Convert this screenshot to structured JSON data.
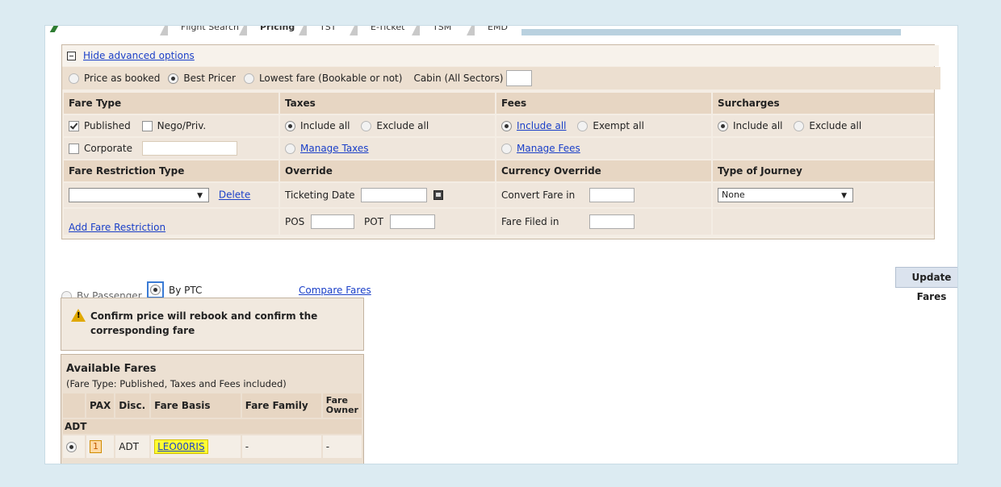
{
  "tabs": [
    "Flight Search",
    "Pricing",
    "TST",
    "E-Ticket",
    "TSM",
    "EMD"
  ],
  "options": {
    "hide_advanced": "Hide advanced options",
    "price_as_booked": "Price as booked",
    "best_pricer": "Best Pricer",
    "lowest_fare": "Lowest fare (Bookable or not)",
    "cabin_label": "Cabin (All Sectors)",
    "cabin_value": ""
  },
  "grid": {
    "fare_type": "Fare Type",
    "taxes": "Taxes",
    "fees": "Fees",
    "surcharges": "Surcharges",
    "published": "Published",
    "nego_priv": "Nego/Priv.",
    "tax_include_all": "Include all",
    "tax_exclude_all": "Exclude all",
    "fee_include_all": "Include all",
    "fee_exempt_all": "Exempt all",
    "sur_include_all": "Include all",
    "sur_exclude_all": "Exclude all",
    "corporate": "Corporate",
    "manage_taxes": "Manage Taxes",
    "manage_fees": "Manage Fees",
    "fare_restriction_type": "Fare Restriction Type",
    "override": "Override",
    "currency_override": "Currency Override",
    "type_of_journey": "Type of Journey",
    "restriction_select": "",
    "delete": "Delete",
    "ticketing_date": "Ticketing Date",
    "convert_fare_in": "Convert Fare in",
    "journey_select": "None",
    "add_fare_restriction": "Add Fare Restriction",
    "pos": "POS",
    "pot": "POT",
    "fare_filed_in": "Fare Filed in"
  },
  "update_fares": "Update Fares",
  "view": {
    "by_passenger": "By Passenger",
    "by_ptc": "By PTC",
    "compare_fares": "Compare Fares"
  },
  "warning": "Confirm price will rebook and confirm the corresponding fare",
  "fares": {
    "title": "Available Fares",
    "subtitle": "(Fare Type: Published, Taxes and Fees included)",
    "columns": [
      "PAX",
      "Disc.",
      "Fare Basis",
      "Fare Family",
      "Fare Owner"
    ],
    "group": "ADT",
    "rows": [
      {
        "pax": "1",
        "disc": "ADT",
        "fare_basis": "LEO00RIS",
        "fare_family": "-",
        "fare_owner": "-"
      }
    ]
  }
}
